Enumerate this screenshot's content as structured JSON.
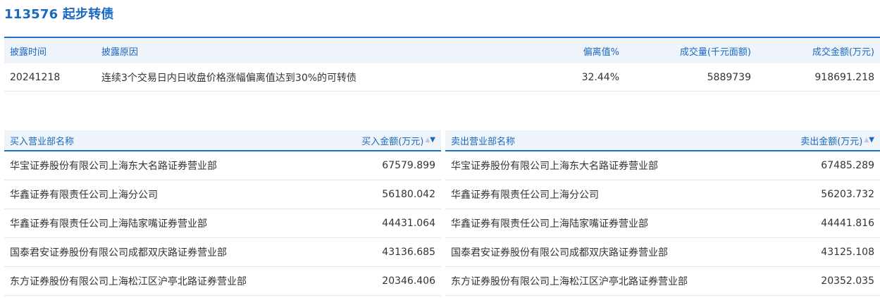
{
  "title": "113576 起步转债",
  "disclosure": {
    "headers": {
      "time": "披露时间",
      "reason": "披露原因",
      "deviation": "偏离值%",
      "volume": "成交量(千元面额)",
      "amount": "成交金额(万元)"
    },
    "row": {
      "time": "20241218",
      "reason": "连续3个交易日内日收盘价格涨幅偏离值达到30%的可转债",
      "deviation": "32.44%",
      "volume": "5889739",
      "amount": "918691.218"
    }
  },
  "buy": {
    "name_header": "买入营业部名称",
    "amount_header": "买入金额(万元)",
    "rows": [
      {
        "name": "华宝证券股份有限公司上海东大名路证券营业部",
        "amount": "67579.899"
      },
      {
        "name": "华鑫证券有限责任公司上海分公司",
        "amount": "56180.042"
      },
      {
        "name": "华鑫证券有限责任公司上海陆家嘴证券营业部",
        "amount": "44431.064"
      },
      {
        "name": "国泰君安证券股份有限公司成都双庆路证券营业部",
        "amount": "43136.685"
      },
      {
        "name": "东方证券股份有限公司上海松江区沪亭北路证券营业部",
        "amount": "20346.406"
      }
    ]
  },
  "sell": {
    "name_header": "卖出营业部名称",
    "amount_header": "卖出金额(万元)",
    "rows": [
      {
        "name": "华宝证券股份有限公司上海东大名路证券营业部",
        "amount": "67485.289"
      },
      {
        "name": "华鑫证券有限责任公司上海分公司",
        "amount": "56203.732"
      },
      {
        "name": "华鑫证券有限责任公司上海陆家嘴证券营业部",
        "amount": "44441.816"
      },
      {
        "name": "国泰君安证券股份有限公司成都双庆路证券营业部",
        "amount": "43125.108"
      },
      {
        "name": "东方证券股份有限公司上海松江区沪亭北路证券营业部",
        "amount": "20352.035"
      }
    ]
  },
  "colors": {
    "accent": "#1a68c0",
    "header_bg": "#eef4fa",
    "row_border": "#dde6ef"
  },
  "icons": {
    "sort": "sort-up-down-icon"
  }
}
